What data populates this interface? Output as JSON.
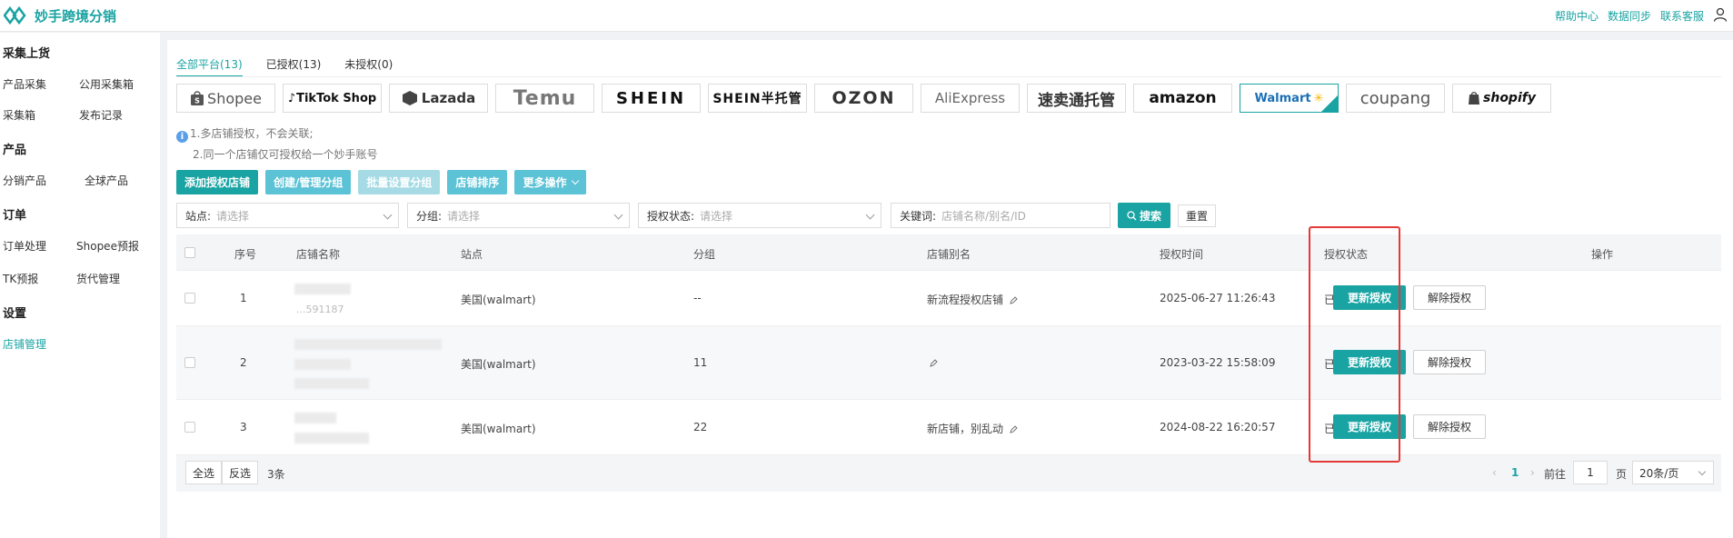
{
  "app": {
    "title": "妙手跨境分销"
  },
  "top_links": [
    "帮助中心",
    "数据同步",
    "联系客服"
  ],
  "sidebar": {
    "sections": [
      {
        "title": "采集上货",
        "items": [
          "产品采集",
          "公用采集箱",
          "采集箱",
          "发布记录"
        ]
      },
      {
        "title": "产品",
        "items": [
          "分销产品",
          "全球产品"
        ]
      },
      {
        "title": "订单",
        "items": [
          "订单处理",
          "Shopee预报",
          "TK预报",
          "货代管理"
        ]
      },
      {
        "title": "设置",
        "items": [
          "店铺管理"
        ]
      }
    ],
    "active": "店铺管理"
  },
  "tabs": [
    {
      "label": "全部平台(13)",
      "active": true
    },
    {
      "label": "已授权(13)",
      "active": false
    },
    {
      "label": "未授权(0)",
      "active": false
    }
  ],
  "platforms": [
    "Shopee",
    "TikTok Shop",
    "Lazada",
    "Temu",
    "SHEIN",
    "SHEIN半托管",
    "OZON",
    "AliExpress",
    "速卖通托管",
    "amazon",
    "Walmart",
    "coupang",
    "shopify"
  ],
  "selected_platform": "Walmart",
  "notes": [
    "1.多店铺授权，不会关联;",
    "2.同一个店铺仅可授权给一个妙手账号"
  ],
  "actions": {
    "add_store": "添加授权店铺",
    "manage_group": "创建/管理分组",
    "batch_group": "批量设置分组",
    "store_sort": "店铺排序",
    "more": "更多操作"
  },
  "filters": {
    "site_label": "站点:",
    "site_placeholder": "请选择",
    "group_label": "分组:",
    "group_placeholder": "请选择",
    "auth_label": "授权状态:",
    "auth_placeholder": "请选择",
    "keyword_label": "关键词:",
    "keyword_placeholder": "店铺名称/别名/ID",
    "search": "搜索",
    "reset": "重置"
  },
  "table": {
    "headers": {
      "index": "序号",
      "store_name": "店铺名称",
      "site": "站点",
      "group": "分组",
      "alias": "店铺别名",
      "auth_time": "授权时间",
      "auth_status": "授权状态",
      "ops": "操作"
    },
    "rows": [
      {
        "index": "1",
        "site": "美国(walmart)",
        "group": "--",
        "alias": "新流程授权店铺",
        "auth_time": "2025-06-27 11:26:43",
        "auth_status": "已授权",
        "name_fragment": "...591187"
      },
      {
        "index": "2",
        "site": "美国(walmart)",
        "group": "11",
        "alias": "",
        "auth_time": "2023-03-22 15:58:09",
        "auth_status": "已授权"
      },
      {
        "index": "3",
        "site": "美国(walmart)",
        "group": "22",
        "alias": "新店铺，别乱动",
        "auth_time": "2024-08-22 16:20:57",
        "auth_status": "已授权"
      }
    ],
    "update_btn": "更新授权",
    "release_btn": "解除授权"
  },
  "footer": {
    "select_all": "全选",
    "invert": "反选",
    "count": "3条",
    "current_page": "1",
    "goto_label": "前往",
    "goto_value": "1",
    "page_unit": "页",
    "page_size": "20条/页"
  }
}
